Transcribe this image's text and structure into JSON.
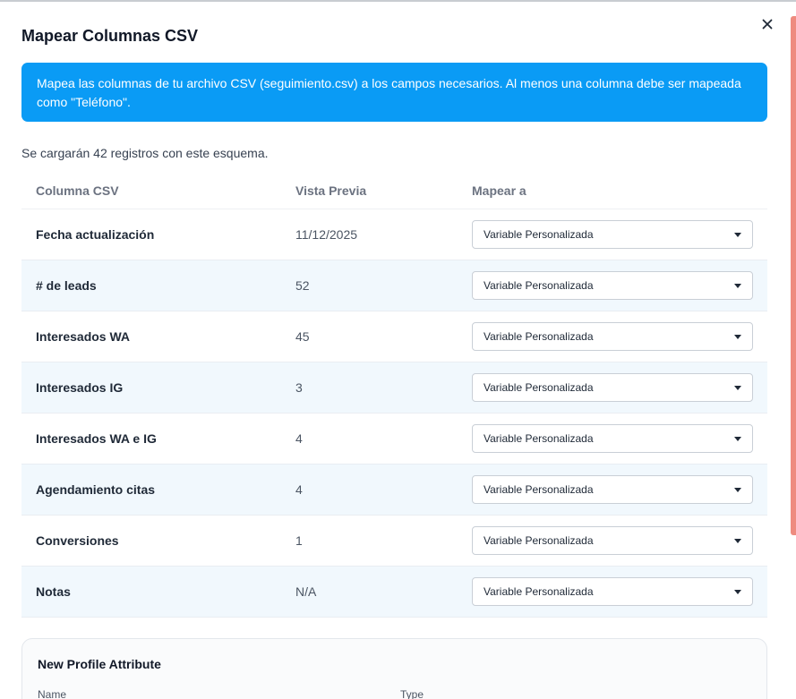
{
  "modal": {
    "title": "Mapear Columnas CSV",
    "close_symbol": "×",
    "info_text": "Mapea las columnas de tu archivo CSV (seguimiento.csv) a los campos necesarios. Al menos una columna debe ser mapeada como \"Teléfono\".",
    "summary": "Se cargarán 42 registros con este esquema."
  },
  "table": {
    "headers": [
      "Columna CSV",
      "Vista Previa",
      "Mapear a"
    ],
    "rows": [
      {
        "column": "Fecha actualización",
        "preview": "11/12/2025",
        "mapping": "Variable Personalizada"
      },
      {
        "column": "# de leads",
        "preview": "52",
        "mapping": "Variable Personalizada"
      },
      {
        "column": "Interesados WA",
        "preview": "45",
        "mapping": "Variable Personalizada"
      },
      {
        "column": "Interesados IG",
        "preview": "3",
        "mapping": "Variable Personalizada"
      },
      {
        "column": "Interesados WA e IG",
        "preview": "4",
        "mapping": "Variable Personalizada"
      },
      {
        "column": "Agendamiento citas",
        "preview": "4",
        "mapping": "Variable Personalizada"
      },
      {
        "column": "Conversiones",
        "preview": "1",
        "mapping": "Variable Personalizada"
      },
      {
        "column": "Notas",
        "preview": "N/A",
        "mapping": "Variable Personalizada"
      }
    ]
  },
  "profile_attribute": {
    "title": "New Profile Attribute",
    "name_label": "Name",
    "type_label": "Type"
  },
  "colors": {
    "banner": "#0a9bf5",
    "row_alt": "#f1f8fd",
    "scroll_accent": "#ee8b7f"
  },
  "icons": {
    "close": "close-icon",
    "dropdown": "chevron-down-icon"
  }
}
